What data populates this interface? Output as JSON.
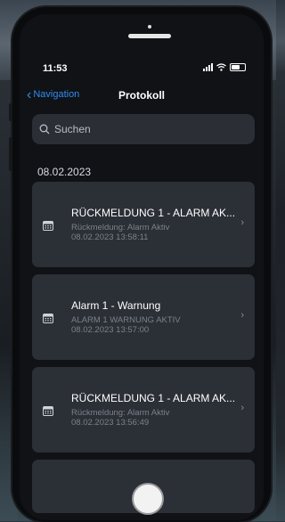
{
  "status_bar": {
    "time": "11:53"
  },
  "nav": {
    "back_label": "Navigation",
    "title": "Protokoll"
  },
  "search": {
    "placeholder": "Suchen"
  },
  "section": {
    "date": "08.02.2023"
  },
  "entries": [
    {
      "title": "RÜCKMELDUNG 1 - ALARM AK...",
      "line1": "Rückmeldung: Alarm Aktiv",
      "line2": "08.02.2023 13:58:11"
    },
    {
      "title": "Alarm 1 - Warnung",
      "line1": "ALARM 1 WARNUNG AKTIV",
      "line2": "08.02.2023 13:57:00"
    },
    {
      "title": "RÜCKMELDUNG 1 - ALARM AK...",
      "line1": "Rückmeldung: Alarm Aktiv",
      "line2": "08.02.2023 13:56:49"
    }
  ],
  "colors": {
    "accent": "#2f8cf0",
    "card_bg": "#2b2f36",
    "screen_bg": "#101216"
  },
  "icons": {
    "calendar": "calendar-icon",
    "chevron": "chevron-right-icon"
  }
}
